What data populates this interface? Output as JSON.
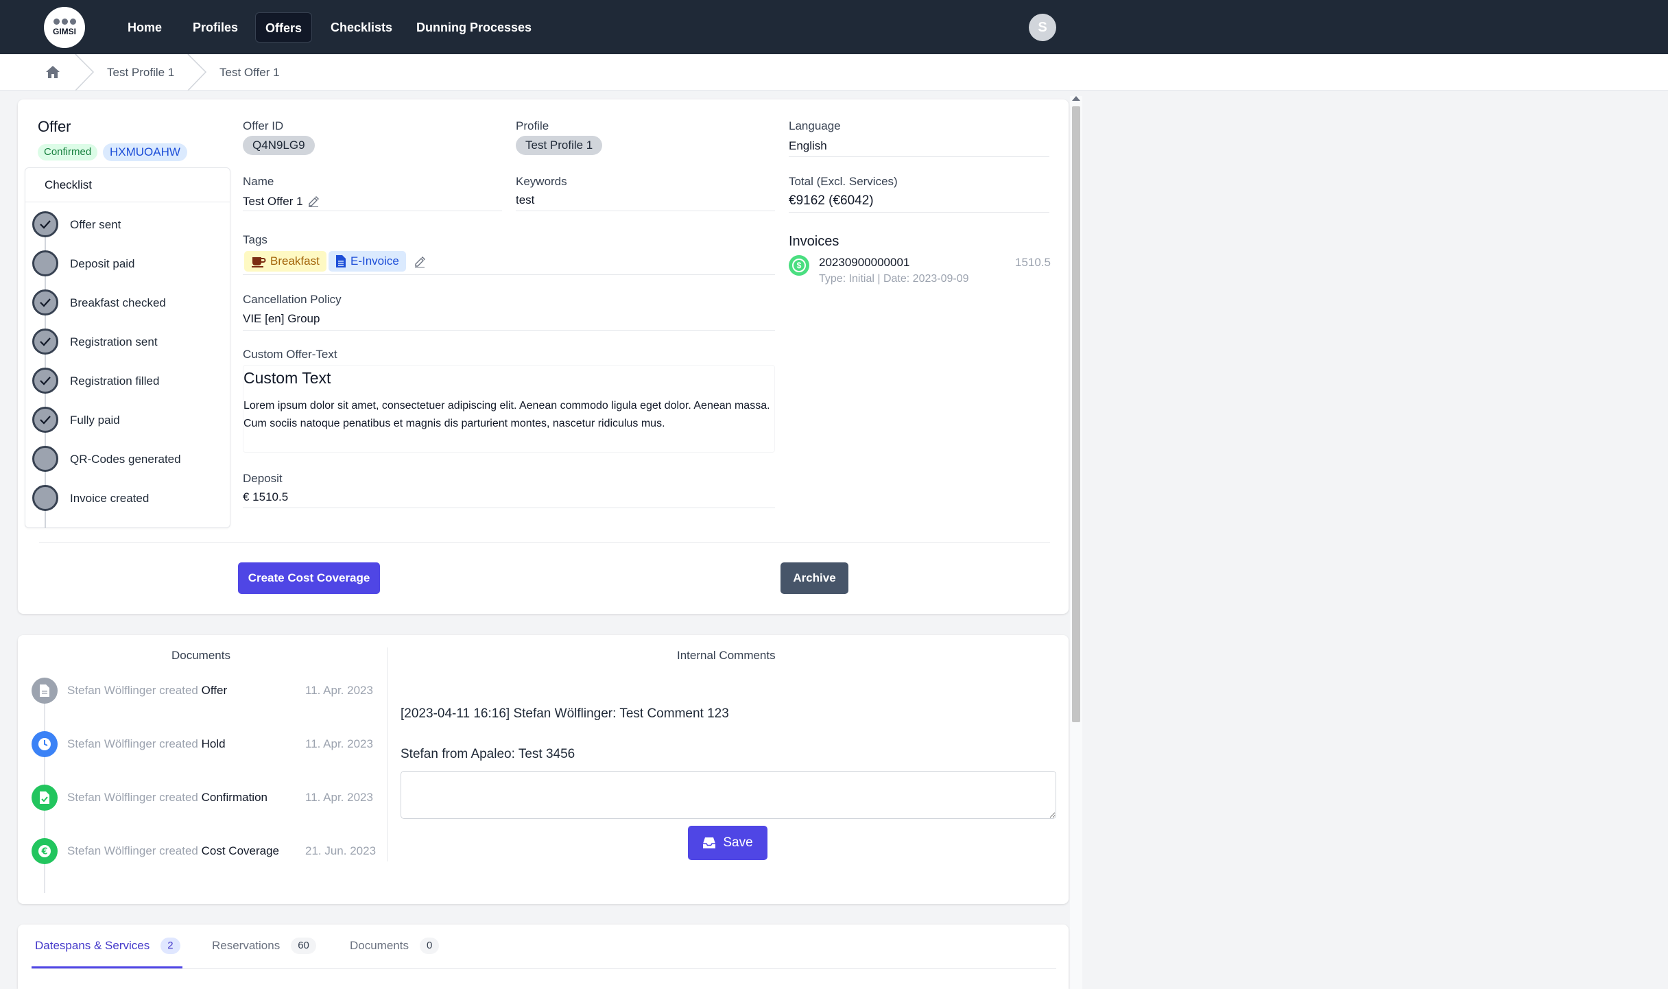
{
  "nav": {
    "logo_text": "GIMSI",
    "items": [
      {
        "label": "Home"
      },
      {
        "label": "Profiles"
      },
      {
        "label": "Offers"
      },
      {
        "label": "Checklists"
      },
      {
        "label": "Dunning Processes"
      }
    ],
    "active": "Offers",
    "avatar_letter": "S"
  },
  "breadcrumb": {
    "items": [
      "Test Profile 1",
      "Test Offer 1"
    ]
  },
  "offer": {
    "title": "Offer",
    "status": "Confirmed",
    "code": "HXMUOAHW",
    "checklist": {
      "title": "Checklist",
      "items": [
        {
          "label": "Offer sent",
          "checked": true
        },
        {
          "label": "Deposit paid",
          "checked": false
        },
        {
          "label": "Breakfast checked",
          "checked": true
        },
        {
          "label": "Registration sent",
          "checked": true
        },
        {
          "label": "Registration filled",
          "checked": true
        },
        {
          "label": "Fully paid",
          "checked": true
        },
        {
          "label": "QR-Codes generated",
          "checked": false
        },
        {
          "label": "Invoice created",
          "checked": false
        }
      ]
    },
    "fields": {
      "offer_id_label": "Offer ID",
      "offer_id": "Q4N9LG9",
      "profile_label": "Profile",
      "profile": "Test Profile 1",
      "language_label": "Language",
      "language": "English",
      "name_label": "Name",
      "name": "Test Offer 1",
      "keywords_label": "Keywords",
      "keywords": "test",
      "total_label": "Total (Excl. Services)",
      "total": "€9162 (€6042)",
      "tags_label": "Tags",
      "tags": [
        "Breakfast",
        "E-Invoice"
      ],
      "cancellation_label": "Cancellation Policy",
      "cancellation": "VIE [en] Group",
      "custom_text_label": "Custom Offer-Text",
      "custom_text_heading": "Custom Text",
      "custom_text_body": "Lorem ipsum dolor sit amet, consectetuer adipiscing elit. Aenean commodo ligula eget dolor. Aenean massa. Cum sociis natoque penatibus et magnis dis parturient montes, nascetur ridiculus mus.",
      "deposit_label": "Deposit",
      "deposit": "€ 1510.5"
    },
    "invoices": {
      "title": "Invoices",
      "items": [
        {
          "number": "20230900000001",
          "amount": "1510.5",
          "meta": "Type: Initial | Date: 2023-09-09"
        }
      ]
    },
    "buttons": {
      "cost_coverage": "Create Cost Coverage",
      "archive": "Archive"
    }
  },
  "documents": {
    "title": "Documents",
    "items": [
      {
        "actor": "Stefan Wölflinger created",
        "doc": "Offer",
        "date": "11. Apr. 2023",
        "color": "#9ca3af",
        "icon": "document-icon"
      },
      {
        "actor": "Stefan Wölflinger created",
        "doc": "Hold",
        "date": "11. Apr. 2023",
        "color": "#3b82f6",
        "icon": "clock-icon"
      },
      {
        "actor": "Stefan Wölflinger created",
        "doc": "Confirmation",
        "date": "11. Apr. 2023",
        "color": "#22c55e",
        "icon": "document-check-icon"
      },
      {
        "actor": "Stefan Wölflinger created",
        "doc": "Cost Coverage",
        "date": "21. Jun. 2023",
        "color": "#22c55e",
        "icon": "euro-icon"
      }
    ]
  },
  "comments": {
    "title": "Internal Comments",
    "items": [
      "[2023-04-11 16:16] Stefan Wölflinger: Test Comment 123",
      "Stefan from Apaleo: Test 3456"
    ],
    "input_value": "",
    "save_label": "Save"
  },
  "tabs": [
    {
      "label": "Datespans & Services",
      "count": "2",
      "active": true
    },
    {
      "label": "Reservations",
      "count": "60",
      "active": false
    },
    {
      "label": "Documents",
      "count": "0",
      "active": false
    }
  ]
}
